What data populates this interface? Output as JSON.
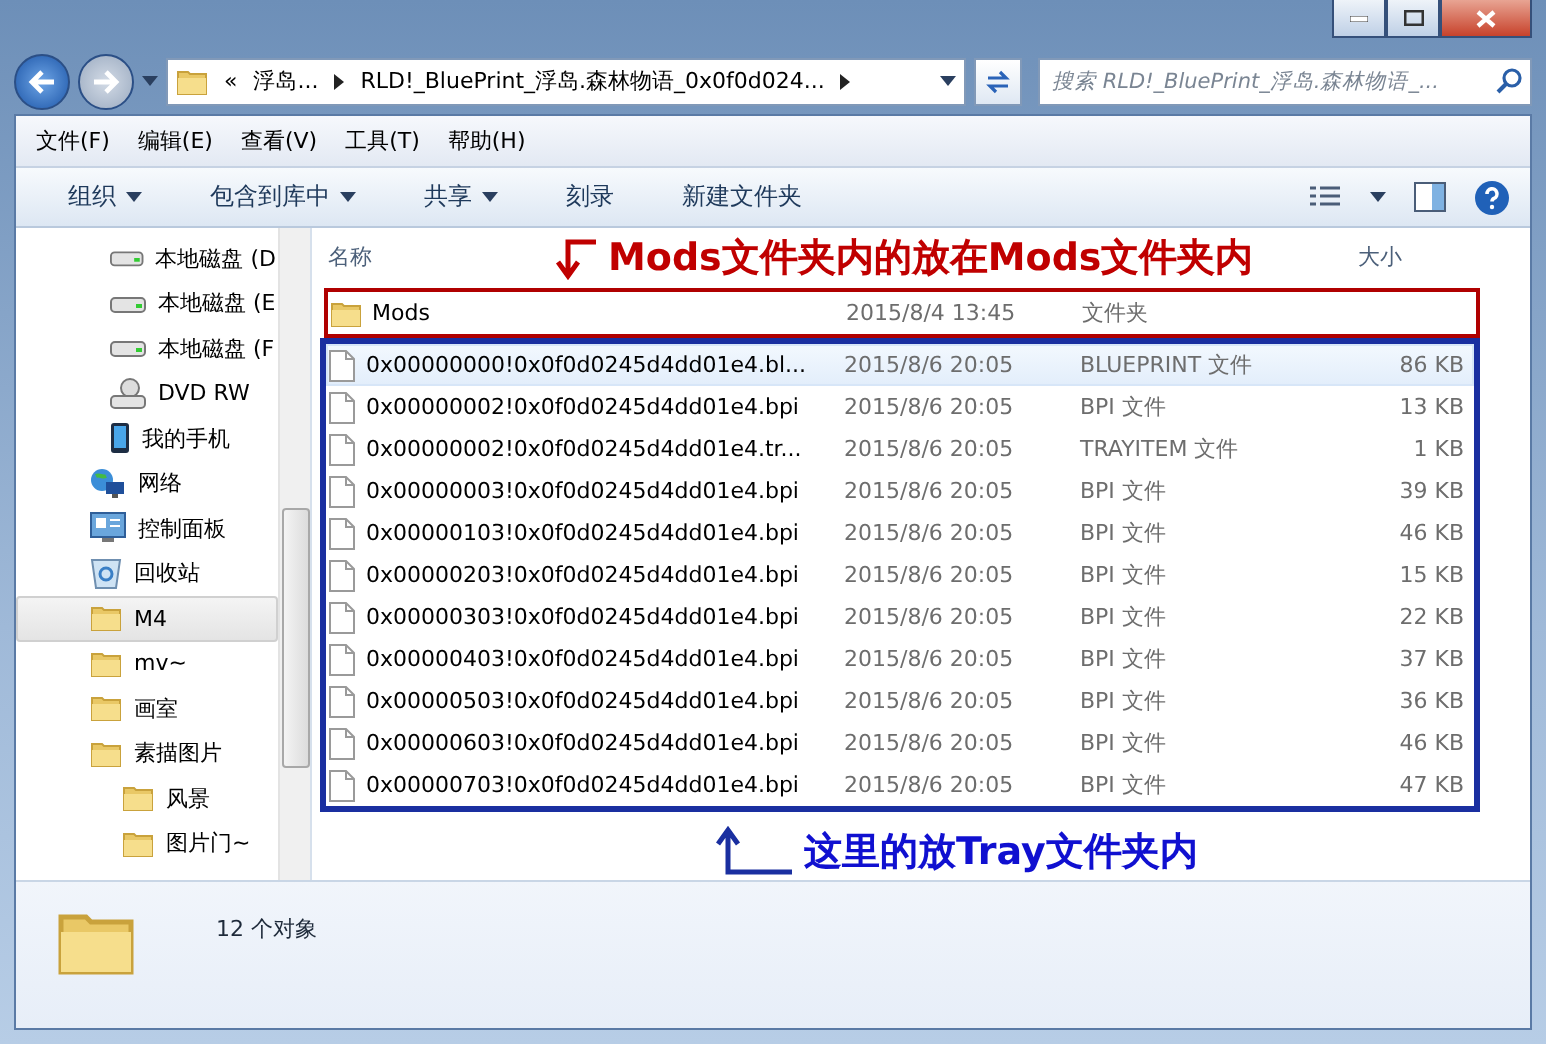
{
  "address": {
    "overflow": "«",
    "crumbs": [
      "浮岛...",
      "RLD!_BluePrint_浮岛.森林物语_0x0f0d024..."
    ]
  },
  "search": {
    "placeholder": "搜索 RLD!_BluePrint_浮岛.森林物语_..."
  },
  "menu": [
    "文件(F)",
    "编辑(E)",
    "查看(V)",
    "工具(T)",
    "帮助(H)"
  ],
  "toolbar": [
    {
      "label": "组织",
      "dropdown": true
    },
    {
      "label": "包含到库中",
      "dropdown": true
    },
    {
      "label": "共享",
      "dropdown": true
    },
    {
      "label": "刻录",
      "dropdown": false
    },
    {
      "label": "新建文件夹",
      "dropdown": false
    }
  ],
  "sidebar": {
    "items": [
      {
        "label": "本地磁盘 (D",
        "kind": "drive",
        "selected": false
      },
      {
        "label": "本地磁盘 (E",
        "kind": "drive",
        "selected": false
      },
      {
        "label": "本地磁盘 (F",
        "kind": "drive",
        "selected": false
      },
      {
        "label": "DVD RW",
        "kind": "dvd",
        "selected": false
      },
      {
        "label": "我的手机",
        "kind": "phone",
        "selected": false
      },
      {
        "label": "网络",
        "kind": "network",
        "selected": false
      },
      {
        "label": "控制面板",
        "kind": "control",
        "selected": false
      },
      {
        "label": "回收站",
        "kind": "recycle",
        "selected": false
      },
      {
        "label": "M4",
        "kind": "folder",
        "selected": true
      },
      {
        "label": "mv~",
        "kind": "folder",
        "selected": false
      },
      {
        "label": "画室",
        "kind": "folder",
        "selected": false
      },
      {
        "label": "素描图片",
        "kind": "folder",
        "selected": false,
        "children": [
          {
            "label": "风景",
            "kind": "folder",
            "selected": false
          },
          {
            "label": "图片门~",
            "kind": "folder",
            "selected": false
          }
        ]
      }
    ]
  },
  "table": {
    "columns": [
      "名称",
      "大小"
    ],
    "folder_rows": [
      {
        "kind": "folder",
        "name": "Mods",
        "date": "2015/8/4 13:45",
        "type": "文件夹",
        "size": "",
        "hovered": false
      }
    ],
    "file_rows": [
      {
        "kind": "file",
        "name": "0x00000000!0x0f0d0245d4dd01e4.bl...",
        "date": "2015/8/6 20:05",
        "type": "BLUEPRINT 文件",
        "size": "86 KB",
        "hovered": true
      },
      {
        "kind": "file",
        "name": "0x00000002!0x0f0d0245d4dd01e4.bpi",
        "date": "2015/8/6 20:05",
        "type": "BPI 文件",
        "size": "13 KB",
        "hovered": false
      },
      {
        "kind": "file",
        "name": "0x00000002!0x0f0d0245d4dd01e4.tr...",
        "date": "2015/8/6 20:05",
        "type": "TRAYITEM 文件",
        "size": "1 KB",
        "hovered": false
      },
      {
        "kind": "file",
        "name": "0x00000003!0x0f0d0245d4dd01e4.bpi",
        "date": "2015/8/6 20:05",
        "type": "BPI 文件",
        "size": "39 KB",
        "hovered": false
      },
      {
        "kind": "file",
        "name": "0x00000103!0x0f0d0245d4dd01e4.bpi",
        "date": "2015/8/6 20:05",
        "type": "BPI 文件",
        "size": "46 KB",
        "hovered": false
      },
      {
        "kind": "file",
        "name": "0x00000203!0x0f0d0245d4dd01e4.bpi",
        "date": "2015/8/6 20:05",
        "type": "BPI 文件",
        "size": "15 KB",
        "hovered": false
      },
      {
        "kind": "file",
        "name": "0x00000303!0x0f0d0245d4dd01e4.bpi",
        "date": "2015/8/6 20:05",
        "type": "BPI 文件",
        "size": "22 KB",
        "hovered": false
      },
      {
        "kind": "file",
        "name": "0x00000403!0x0f0d0245d4dd01e4.bpi",
        "date": "2015/8/6 20:05",
        "type": "BPI 文件",
        "size": "37 KB",
        "hovered": false
      },
      {
        "kind": "file",
        "name": "0x00000503!0x0f0d0245d4dd01e4.bpi",
        "date": "2015/8/6 20:05",
        "type": "BPI 文件",
        "size": "36 KB",
        "hovered": false
      },
      {
        "kind": "file",
        "name": "0x00000603!0x0f0d0245d4dd01e4.bpi",
        "date": "2015/8/6 20:05",
        "type": "BPI 文件",
        "size": "46 KB",
        "hovered": false
      },
      {
        "kind": "file",
        "name": "0x00000703!0x0f0d0245d4dd01e4.bpi",
        "date": "2015/8/6 20:05",
        "type": "BPI 文件",
        "size": "47 KB",
        "hovered": false
      }
    ]
  },
  "annotations": [
    {
      "text": "Mods文件夹内的放在Mods文件夹内",
      "color": "#c00000"
    },
    {
      "text": "这里的放Tray文件夹内",
      "color": "#1010d0"
    }
  ],
  "status_bar": {
    "text": "12 个对象"
  }
}
